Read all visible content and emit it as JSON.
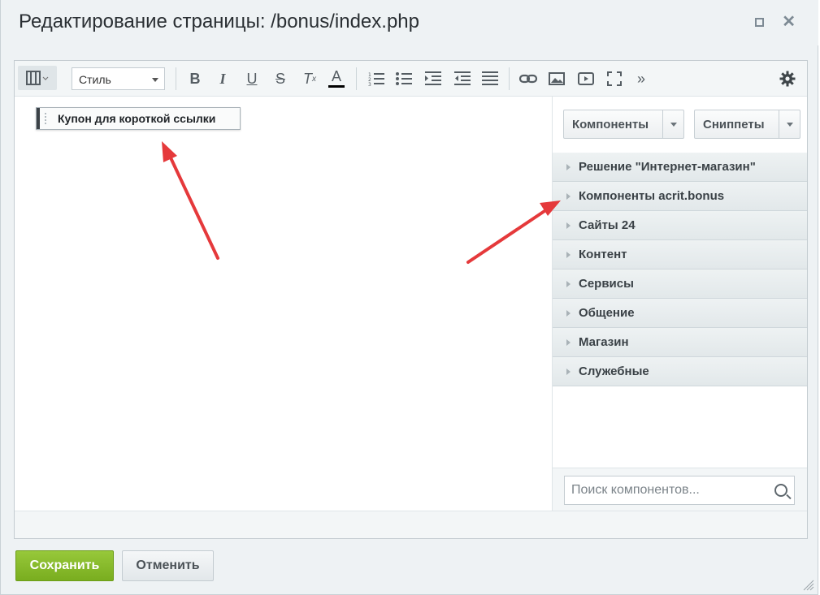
{
  "dialog": {
    "title": "Редактирование страницы: /bonus/index.php"
  },
  "toolbar": {
    "style_select": "Стиль",
    "buttons": [
      {
        "name": "bold-icon",
        "glyph": "B"
      },
      {
        "name": "italic-icon",
        "glyph": "I"
      },
      {
        "name": "underline-icon",
        "glyph": "U"
      },
      {
        "name": "strikethrough-icon",
        "glyph": "S"
      },
      {
        "name": "remove-format-icon",
        "glyph": "T"
      },
      {
        "name": "text-color-icon",
        "glyph": "A"
      }
    ]
  },
  "content": {
    "component_label": "Купон для короткой ссылки"
  },
  "sidebar": {
    "components_button": "Компоненты",
    "snippets_button": "Сниппеты",
    "groups": [
      "Решение \"Интернет-магазин\"",
      "Компоненты acrit.bonus",
      "Сайты 24",
      "Контент",
      "Сервисы",
      "Общение",
      "Магазин",
      "Служебные"
    ],
    "search_placeholder": "Поиск компонентов..."
  },
  "footer": {
    "save_label": "Сохранить",
    "cancel_label": "Отменить"
  },
  "colors": {
    "save": "#79ad1f",
    "annotation_arrow": "#e5393b"
  }
}
